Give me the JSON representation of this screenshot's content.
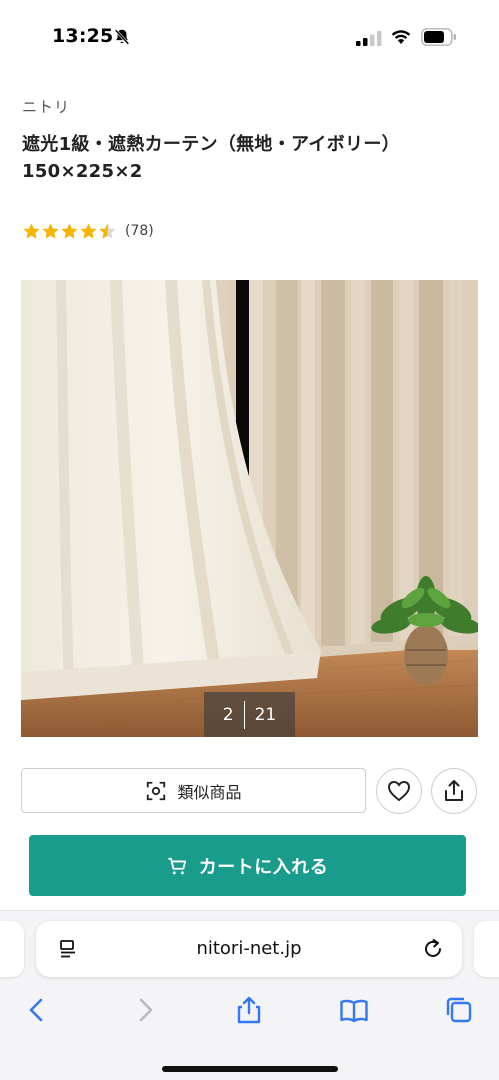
{
  "status_bar": {
    "time": "13:25",
    "icons": [
      "bell-slash-icon",
      "cellular-signal-icon",
      "wifi-icon",
      "battery-icon"
    ]
  },
  "product": {
    "brand": "ニトリ",
    "title": "遮光1級・遮熱カーテン（無地・アイボリー） 150×225×2",
    "rating": 4.5,
    "review_count": "(78)",
    "image_counter": {
      "current": "2",
      "total": "21"
    }
  },
  "actions": {
    "similar_label": "類似商品",
    "similar_icon": "camera-scan-icon",
    "favorite_icon": "heart-icon",
    "share_icon": "share-icon",
    "cart_label": "カートに入れる",
    "cart_icon": "cart-icon"
  },
  "browser": {
    "url": "nitori-net.jp",
    "toolbar": [
      "back-icon",
      "forward-icon",
      "share-icon",
      "bookmarks-icon",
      "tabs-icon"
    ]
  },
  "colors": {
    "accent": "#1a9c8c",
    "star": "#f5b400",
    "safari_blue": "#3478f6"
  }
}
